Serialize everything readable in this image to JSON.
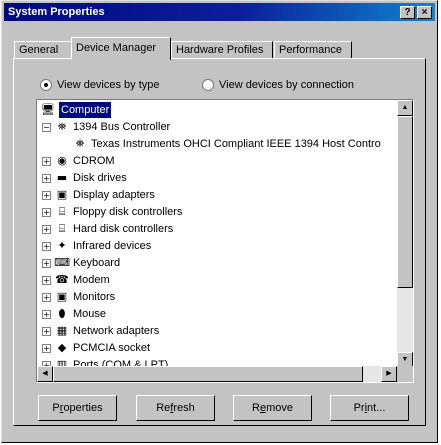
{
  "window": {
    "title": "System Properties",
    "help_glyph": "?",
    "close_glyph": "×"
  },
  "tabs": [
    {
      "label": "General"
    },
    {
      "label": "Device Manager"
    },
    {
      "label": "Hardware Profiles"
    },
    {
      "label": "Performance"
    }
  ],
  "view_options": {
    "by_type": "View devices by type",
    "by_connection": "View devices by connection",
    "selected": "by_type"
  },
  "tree": [
    {
      "label": "Computer",
      "selected": true,
      "icon": "computer-icon",
      "glyph": "🖥"
    },
    {
      "label": "1394 Bus Controller",
      "expander": "−",
      "icon": "bus-controller-icon",
      "glyph": "⛯"
    },
    {
      "label": "Texas Instruments OHCI Compliant IEEE 1394 Host Contro",
      "icon": "device-icon",
      "glyph": "⛯"
    },
    {
      "label": "CDROM",
      "expander": "+",
      "icon": "cdrom-icon",
      "glyph": "◉"
    },
    {
      "label": "Disk drives",
      "expander": "+",
      "icon": "disk-drive-icon",
      "glyph": "▬"
    },
    {
      "label": "Display adapters",
      "expander": "+",
      "icon": "display-adapter-icon",
      "glyph": "▣"
    },
    {
      "label": "Floppy disk controllers",
      "expander": "+",
      "icon": "floppy-controller-icon",
      "glyph": "⌸"
    },
    {
      "label": "Hard disk controllers",
      "expander": "+",
      "icon": "hard-disk-controller-icon",
      "glyph": "⌸"
    },
    {
      "label": "Infrared devices",
      "expander": "+",
      "icon": "infrared-icon",
      "glyph": "✦"
    },
    {
      "label": "Keyboard",
      "expander": "+",
      "icon": "keyboard-icon",
      "glyph": "⌨"
    },
    {
      "label": "Modem",
      "expander": "+",
      "icon": "modem-icon",
      "glyph": "☎"
    },
    {
      "label": "Monitors",
      "expander": "+",
      "icon": "monitor-icon",
      "glyph": "▣"
    },
    {
      "label": "Mouse",
      "expander": "+",
      "icon": "mouse-icon",
      "glyph": "⬮"
    },
    {
      "label": "Network adapters",
      "expander": "+",
      "icon": "network-adapter-icon",
      "glyph": "▦"
    },
    {
      "label": "PCMCIA socket",
      "expander": "+",
      "icon": "pcmcia-icon",
      "glyph": "◆"
    },
    {
      "label": "Ports (COM & LPT)",
      "expander": "+",
      "icon": "ports-icon",
      "glyph": "▥"
    }
  ],
  "buttons": {
    "properties": {
      "pre": "P",
      "accel": "r",
      "post": "operties"
    },
    "refresh": {
      "pre": "Re",
      "accel": "f",
      "post": "resh"
    },
    "remove": {
      "pre": "R",
      "accel": "e",
      "post": "move"
    },
    "print": {
      "pre": "Pr",
      "accel": "i",
      "post": "nt..."
    }
  }
}
